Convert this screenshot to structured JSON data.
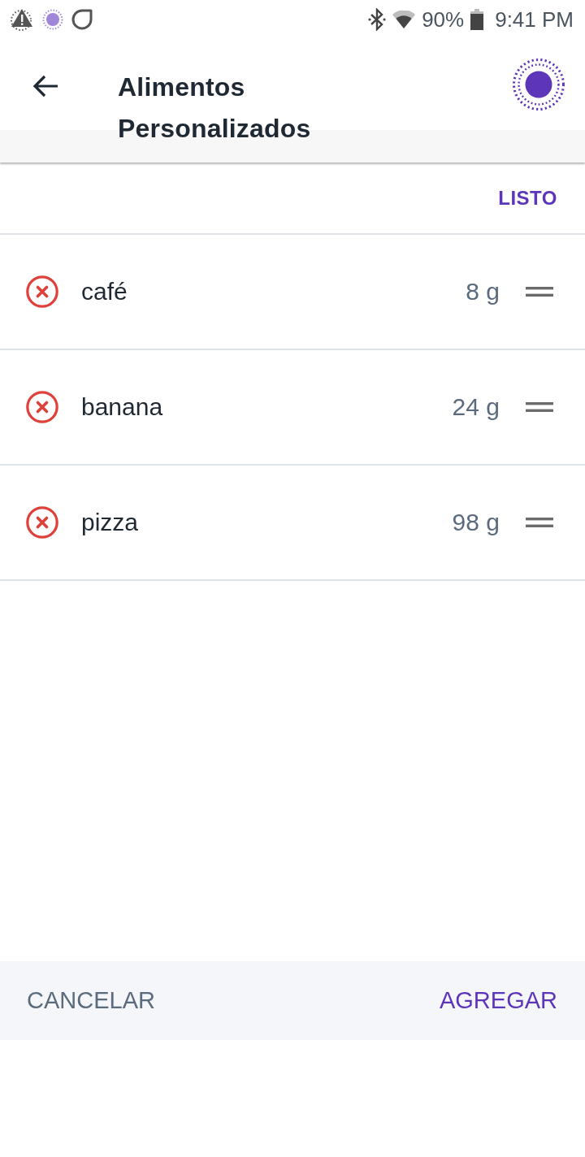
{
  "status_bar": {
    "battery": "90%",
    "time": "9:41 PM"
  },
  "app_bar": {
    "title": "Alimentos Personalizados"
  },
  "edit_bar": {
    "done_label": "LISTO"
  },
  "foods": [
    {
      "name": "café",
      "amount": "8 g"
    },
    {
      "name": "banana",
      "amount": "24 g"
    },
    {
      "name": "pizza",
      "amount": "98 g"
    }
  ],
  "footer": {
    "cancel_label": "CANCELAR",
    "add_label": "AGREGAR"
  }
}
